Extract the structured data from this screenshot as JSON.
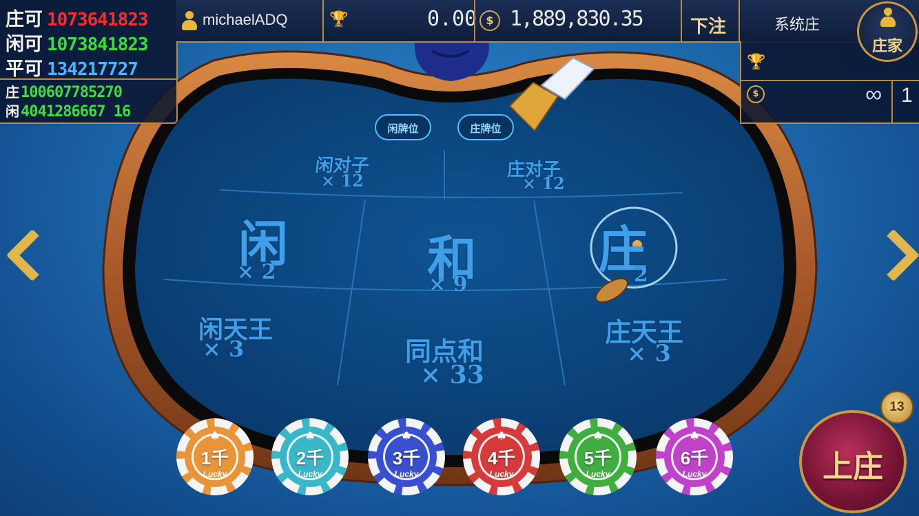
{
  "stats": {
    "banker_limit_label": "庄可",
    "banker_limit_value": "1073641823",
    "player_limit_label": "闲可",
    "player_limit_value": "1073841823",
    "tie_limit_label": "平可",
    "tie_limit_value": "134217727",
    "banker_total_label": "庄",
    "banker_total_value": "100607785270",
    "player_total_label": "闲",
    "player_total_value": "4041286667 16"
  },
  "topbar": {
    "username": "michaelADQ",
    "bet_amount": "0.00",
    "balance": "1,889,830.35",
    "bet_label": "下注",
    "system_banker_label": "系统庄",
    "banker_button_label": "庄家"
  },
  "banker_panel": {
    "infinity": "∞",
    "count": "1"
  },
  "table": {
    "player_card_pos": "闲牌位",
    "banker_card_pos": "庄牌位",
    "player_pair": "闲对子",
    "player_pair_odds": "× 12",
    "banker_pair": "庄对子",
    "banker_pair_odds": "× 12",
    "player": "闲",
    "player_odds": "× 2",
    "tie": "和",
    "tie_odds": "× 9",
    "banker": "庄",
    "banker_odds": "2",
    "player_natural": "闲天王",
    "player_natural_odds": "× 3",
    "same_point_tie": "同点和",
    "same_point_tie_odds": "× 33",
    "banker_natural": "庄天王",
    "banker_natural_odds": "× 3"
  },
  "chips": [
    {
      "label": "1千",
      "lucky": "Lucky",
      "color": "#e8953a"
    },
    {
      "label": "2千",
      "lucky": "Lucky",
      "color": "#39b7c8"
    },
    {
      "label": "3千",
      "lucky": "Lucky",
      "color": "#3850d0"
    },
    {
      "label": "4千",
      "lucky": "Lucky",
      "color": "#d63a3a"
    },
    {
      "label": "5千",
      "lucky": "Lucky",
      "color": "#3fae3f"
    },
    {
      "label": "6千",
      "lucky": "Lucky",
      "color": "#c042c8"
    }
  ],
  "become_banker": {
    "label": "上庄",
    "badge": "13"
  },
  "colors": {
    "felt": "#0c4a85",
    "rail": "#b5652a",
    "gold": "#c9993f",
    "banker_value": "#ff2a2a",
    "player_value": "#35e035",
    "tie_value": "#4ab6ff",
    "banker_total": "#3fdc3f",
    "player_total": "#3fdc3f"
  },
  "icons": [
    "user-icon",
    "trophy-icon",
    "coin-icon",
    "arrow-left-icon",
    "arrow-right-icon",
    "clover-icon"
  ]
}
